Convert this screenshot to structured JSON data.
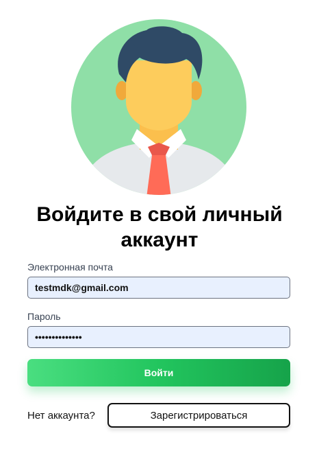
{
  "avatar": {
    "icon": "user-avatar-icon"
  },
  "title": "Войдите в свой личный аккаунт",
  "email": {
    "label": "Электронная почта",
    "value": "testmdk@gmail.com"
  },
  "password": {
    "label": "Пароль",
    "value": "••••••••••••••"
  },
  "login_button": "Войти",
  "signup_prompt": "Нет аккаунта?",
  "register_button": "Зарегистрироваться",
  "colors": {
    "accent": "#22c55e",
    "input_bg": "#e8f0fe",
    "avatar_bg": "#8fdfa7"
  }
}
